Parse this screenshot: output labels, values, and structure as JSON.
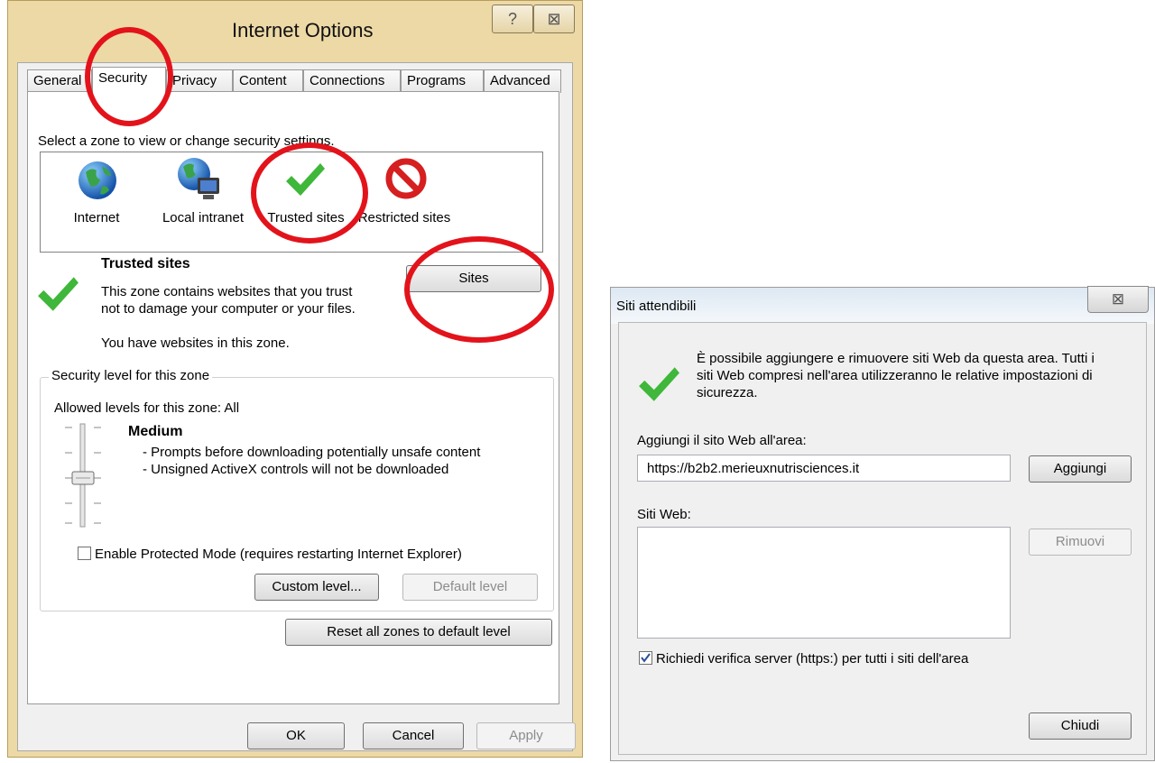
{
  "internet_options": {
    "title": "Internet Options",
    "help_glyph": "?",
    "close_glyph": "⊠",
    "tabs": [
      "General",
      "Security",
      "Privacy",
      "Content",
      "Connections",
      "Programs",
      "Advanced"
    ],
    "active_tab": "Security",
    "zone_prompt": "Select a zone to view or change security settings.",
    "zones": [
      {
        "label": "Internet",
        "icon": "globe-icon"
      },
      {
        "label": "Local intranet",
        "icon": "intranet-icon"
      },
      {
        "label": "Trusted sites",
        "icon": "checkmark-icon"
      },
      {
        "label": "Restricted sites",
        "icon": "restricted-icon"
      }
    ],
    "selected_zone": {
      "title": "Trusted sites",
      "description": "This zone contains websites that you trust not to damage your computer or your files.",
      "has_sites": "You have websites in this zone."
    },
    "sites_button": "Sites",
    "security_group": {
      "legend": "Security level for this zone",
      "allowed": "Allowed levels for this zone: All",
      "level_name": "Medium",
      "level_bullets": [
        "- Prompts before downloading potentially unsafe content",
        "- Unsigned ActiveX controls will not be downloaded"
      ],
      "slider_level": "Medium",
      "protected_mode_label": "Enable Protected Mode (requires restarting Internet Explorer)",
      "protected_mode_checked": false,
      "custom_level_button": "Custom level...",
      "default_level_button": "Default level"
    },
    "reset_button": "Reset all zones to default level",
    "ok_button": "OK",
    "cancel_button": "Cancel",
    "apply_button": "Apply"
  },
  "siti_attendibili": {
    "title": "Siti attendibili",
    "close_glyph": "⊠",
    "description": "È possibile aggiungere e rimuovere siti Web da questa area. Tutti i siti Web compresi nell'area utilizzeranno le relative impostazioni di sicurezza.",
    "add_label": "Aggiungi il sito Web all'area:",
    "add_value": "https://b2b2.merieuxnutrisciences.it",
    "add_button": "Aggiungi",
    "list_label": "Siti Web:",
    "list_items": [],
    "remove_button": "Rimuovi",
    "verify_label": "Richiedi verifica server (https:) per tutti i siti dell'area",
    "verify_checked": true,
    "close_button": "Chiudi"
  },
  "colors": {
    "annotation_red": "#e3131b",
    "checkmark_green": "#3fb73a",
    "window_frame": "#ecd9a6"
  }
}
